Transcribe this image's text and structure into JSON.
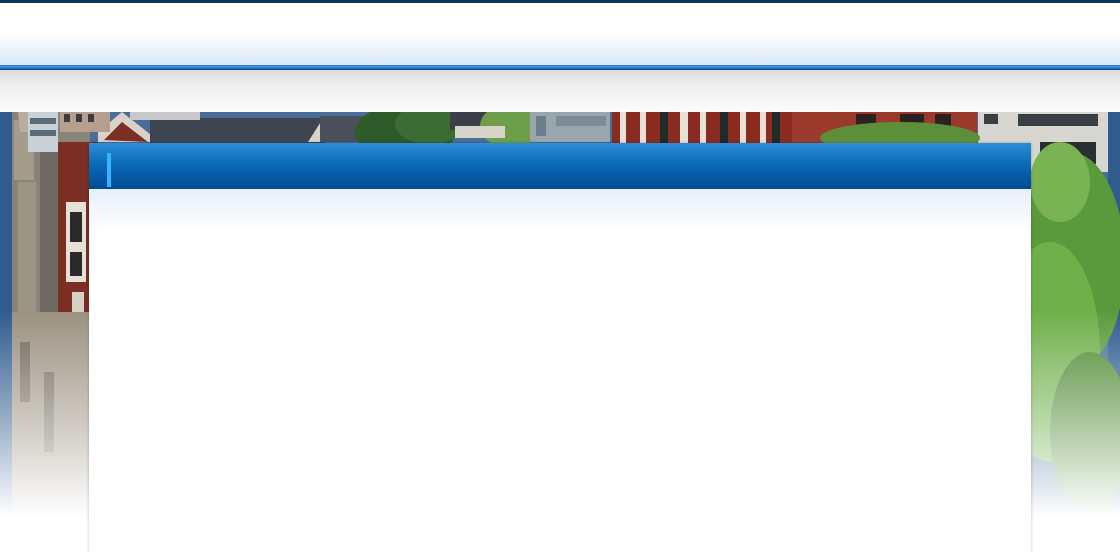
{
  "header": {
    "title": ""
  },
  "hero": {
    "image": "campus-buildings-photo"
  },
  "panel": {
    "title": "",
    "body": ""
  },
  "colors": {
    "top_rule": "#0e3358",
    "header_rule": "#2f7fce",
    "panel_header_top": "#2c8fd6",
    "panel_header_bottom": "#004a95",
    "panel_accent": "#33b6ff"
  }
}
